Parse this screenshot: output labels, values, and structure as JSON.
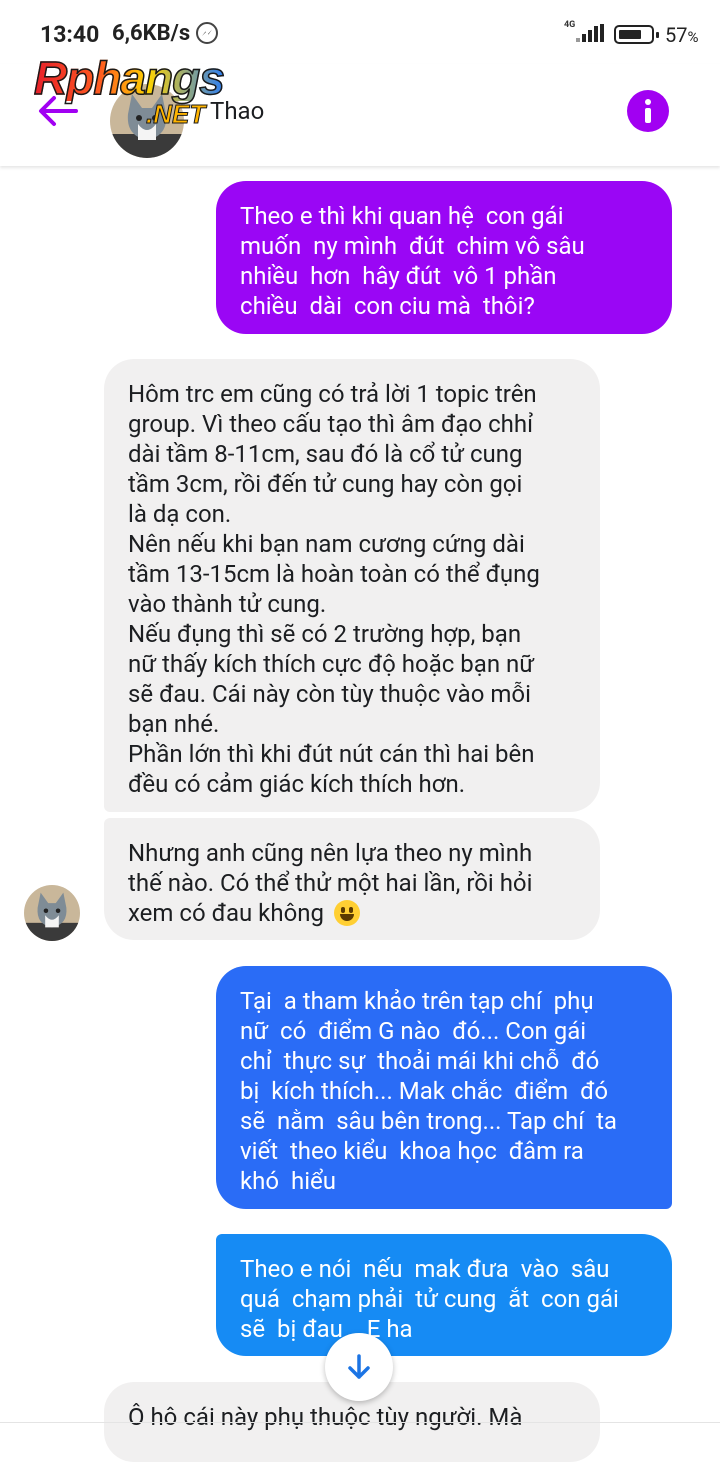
{
  "status_bar": {
    "time": "13:40",
    "speed": "6,6KB/s",
    "network": "4G",
    "battery": "57",
    "battery_unit": "%",
    "notification_icon": "messenger-icon"
  },
  "watermark": {
    "main": "Rphangs",
    "sub": ".NET"
  },
  "header": {
    "contact_name": "Thao",
    "back_icon": "back-arrow-icon",
    "info_icon": "info-icon",
    "accent": "#a100f2"
  },
  "messages": [
    {
      "direction": "sent",
      "color": "#9a06f5",
      "lines": [
        "Theo e thì khi quan hệ  con gái",
        "muốn  ny mình  đút  chim vô sâu",
        "nhiều  hơn  hây đút  vô 1 phần",
        "chiều  dài  con ciu mà  thôi?"
      ]
    },
    {
      "direction": "received",
      "lines": [
        "Hôm trc em cũng có trả lời 1 topic trên",
        "group. Vì theo cấu tạo thì âm đạo chhỉ",
        "dài tầm 8-11cm, sau đó là cổ tử cung",
        "tầm 3cm, rồi đến tử cung hay còn gọi",
        "là dạ con.",
        "Nên nếu khi bạn nam cương cứng dài",
        "tầm 13-15cm là hoàn toàn có thể đụng",
        "vào thành tử cung.",
        "Nếu đụng thì sẽ có 2 trường hợp, bạn",
        "nữ thấy kích thích cực độ hoặc bạn nữ",
        "sẽ đau. Cái này còn tùy thuộc vào mỗi",
        "bạn nhé.",
        "Phần lớn thì khi đút nút cán thì hai bên",
        "đều có cảm giác kích thích hơn."
      ]
    },
    {
      "direction": "received",
      "lines": [
        "Nhưng anh cũng nên lựa theo ny mình",
        "thế nào. Có thể thử một hai lần, rồi hỏi",
        "xem có đau không"
      ],
      "emoji": "grinning-face-emoji"
    },
    {
      "direction": "sent",
      "color": "#2a6cf6",
      "lines": [
        "Tại  a tham khảo trên tạp chí  phụ",
        "nữ  có  điểm G nào  đó... Con gái",
        "chỉ  thực sự  thoải mái khi chỗ  đó",
        "bị  kích thích... Mak chắc  điểm  đó",
        "sẽ  nằm  sâu bên trong... Tap chí  ta",
        "viết  theo kiểu  khoa học  đâm ra",
        "khó  hiểu"
      ]
    },
    {
      "direction": "sent",
      "color": "#168bf4",
      "lines": [
        "Theo e nói  nếu  mak đưa  vào  sâu",
        "quá  chạm phải  tử cung  ắt  con gái",
        "sẽ  bị đau    E ha"
      ]
    },
    {
      "direction": "received",
      "lines": [
        "Ô hô cái này phụ thuộc tùy người. Mà"
      ]
    }
  ],
  "scroll_button_icon": "arrow-down-icon"
}
